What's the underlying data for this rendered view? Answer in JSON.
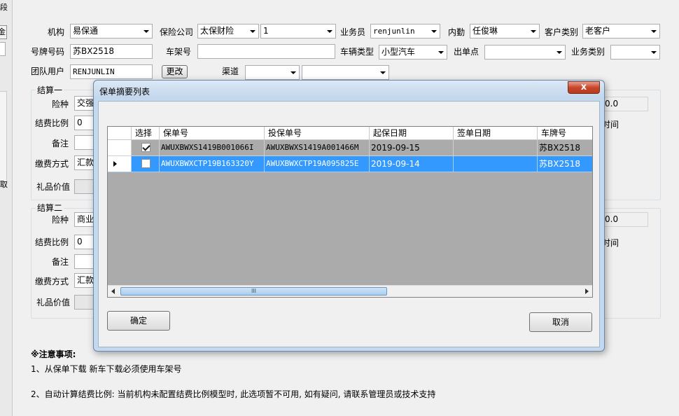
{
  "left_edge": {
    "top_char": "段",
    "btn_char": "金",
    "side_char": "取"
  },
  "form": {
    "jigou_label": "机构",
    "jigou_value": "易保通",
    "baoxian_label": "保险公司",
    "baoxian_value": "太保财险",
    "baoxian_code": "1",
    "yewuyuan_label": "业务员",
    "yewuyuan_value": "renjunlin",
    "neiqin_label": "内勤",
    "neiqin_value": "任俊琳",
    "kehu_label": "客户类别",
    "kehu_value": "老客户",
    "haopai_label": "号牌号码",
    "haopai_value": "苏BX2518",
    "chejia_label": "车架号",
    "chejia_value": "",
    "cheliang_label": "车辆类型",
    "cheliang_value": "小型汽车",
    "chudan_label": "出单点",
    "chudan_value": "",
    "yewulei_label": "业务类别",
    "yewulei_value": "",
    "tuandui_label": "团队用户",
    "tuandui_value": "RENJUNLIN",
    "change_label": "更改",
    "qudao_label": "渠道",
    "qudao_value1": "",
    "qudao_value2": ""
  },
  "settle1": {
    "title": "结算一",
    "xianzhong_label": "险种",
    "xianzhong_value": "交强",
    "bili_label": "结费比例",
    "bili_value": "0",
    "beizhu_label": "备注",
    "jiaofei_label": "缴费方式",
    "jiaofei_value": "汇款",
    "lipin_label": "礼品价值",
    "right_value": "0.0",
    "right_label": "时间"
  },
  "settle2": {
    "title": "结算二",
    "xianzhong_label": "险种",
    "xianzhong_value": "商业",
    "bili_label": "结费比例",
    "bili_value": "0",
    "beizhu_label": "备注",
    "jiaofei_label": "缴费方式",
    "jiaofei_value": "汇款",
    "lipin_label": "礼品价值",
    "right_value": "0.0",
    "right_label": "时间"
  },
  "notes": {
    "title": "※注意事项:",
    "line1": "1、从保单下载 新车下载必须使用车架号",
    "line2": "2、自动计算结费比例: 当前机构未配置结费比例模型时, 此选项暂不可用, 如有疑问, 请联系管理员或技术支持"
  },
  "dialog": {
    "title": "保单摘要列表",
    "close_label": "x",
    "columns": [
      "选择",
      "保单号",
      "投保单号",
      "起保日期",
      "签单日期",
      "车牌号"
    ],
    "rows": [
      {
        "checked": true,
        "baodan": "AWUXBWXS1419B001066I",
        "toubao": "AWUXBWXS1419A001466M",
        "qibao": "2019-09-15",
        "qiandan": "",
        "chepai": "苏BX2518",
        "selected": false
      },
      {
        "checked": false,
        "baodan": "AWUXBWXCTP19B163320Y",
        "toubao": "AWUXBWXCTP19A095825E",
        "qibao": "2019-09-14",
        "qiandan": "",
        "chepai": "苏BX2518",
        "selected": true
      }
    ],
    "scroll_grip": "III",
    "ok_label": "确定",
    "cancel_label": "取消"
  },
  "colors": {
    "selection": "#3399ff",
    "grid_bg": "#ababab",
    "dialog_frame": "#c5d9ee"
  }
}
